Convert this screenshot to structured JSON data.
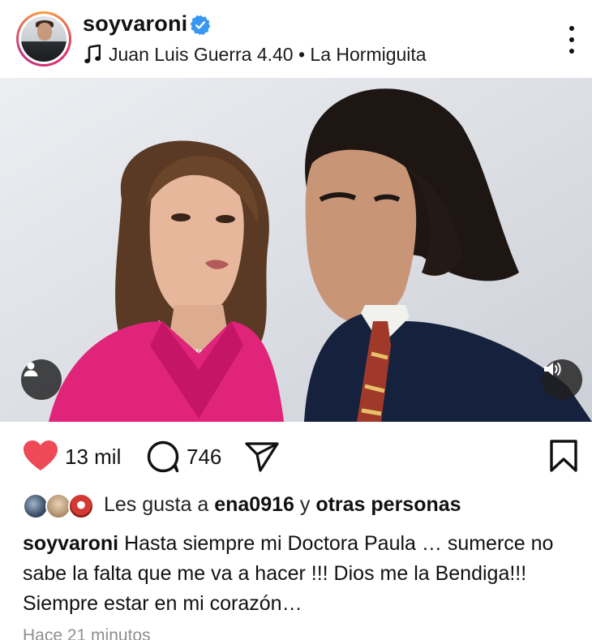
{
  "post": {
    "username": "soyvaroni",
    "verified": true,
    "music": "Juan Luis Guerra 4.40 • La Hormiguita",
    "more_icon": "more-vertical-icon"
  },
  "media": {
    "tag_icon": "person-tag-icon",
    "sound_icon": "speaker-icon"
  },
  "actions": {
    "likes_count": "13 mil",
    "comments_count": "746",
    "liked": true,
    "heart_color": "#ED4956"
  },
  "likers": {
    "prefix": "Les gusta a",
    "user": "ena0916",
    "joiner": "y",
    "others": "otras personas"
  },
  "caption": {
    "username": "soyvaroni",
    "text": "Hasta siempre mi Doctora Paula … sumerce no sabe la falta que me va a hacer !!! Dios me la Bendiga!!! Siempre estar en mi corazón…"
  },
  "timestamp": "Hace 21 minutos",
  "colors": {
    "verified_blue": "#3897F0",
    "story_ring": "#E1306C",
    "muted_text": "#8E8E8E"
  }
}
